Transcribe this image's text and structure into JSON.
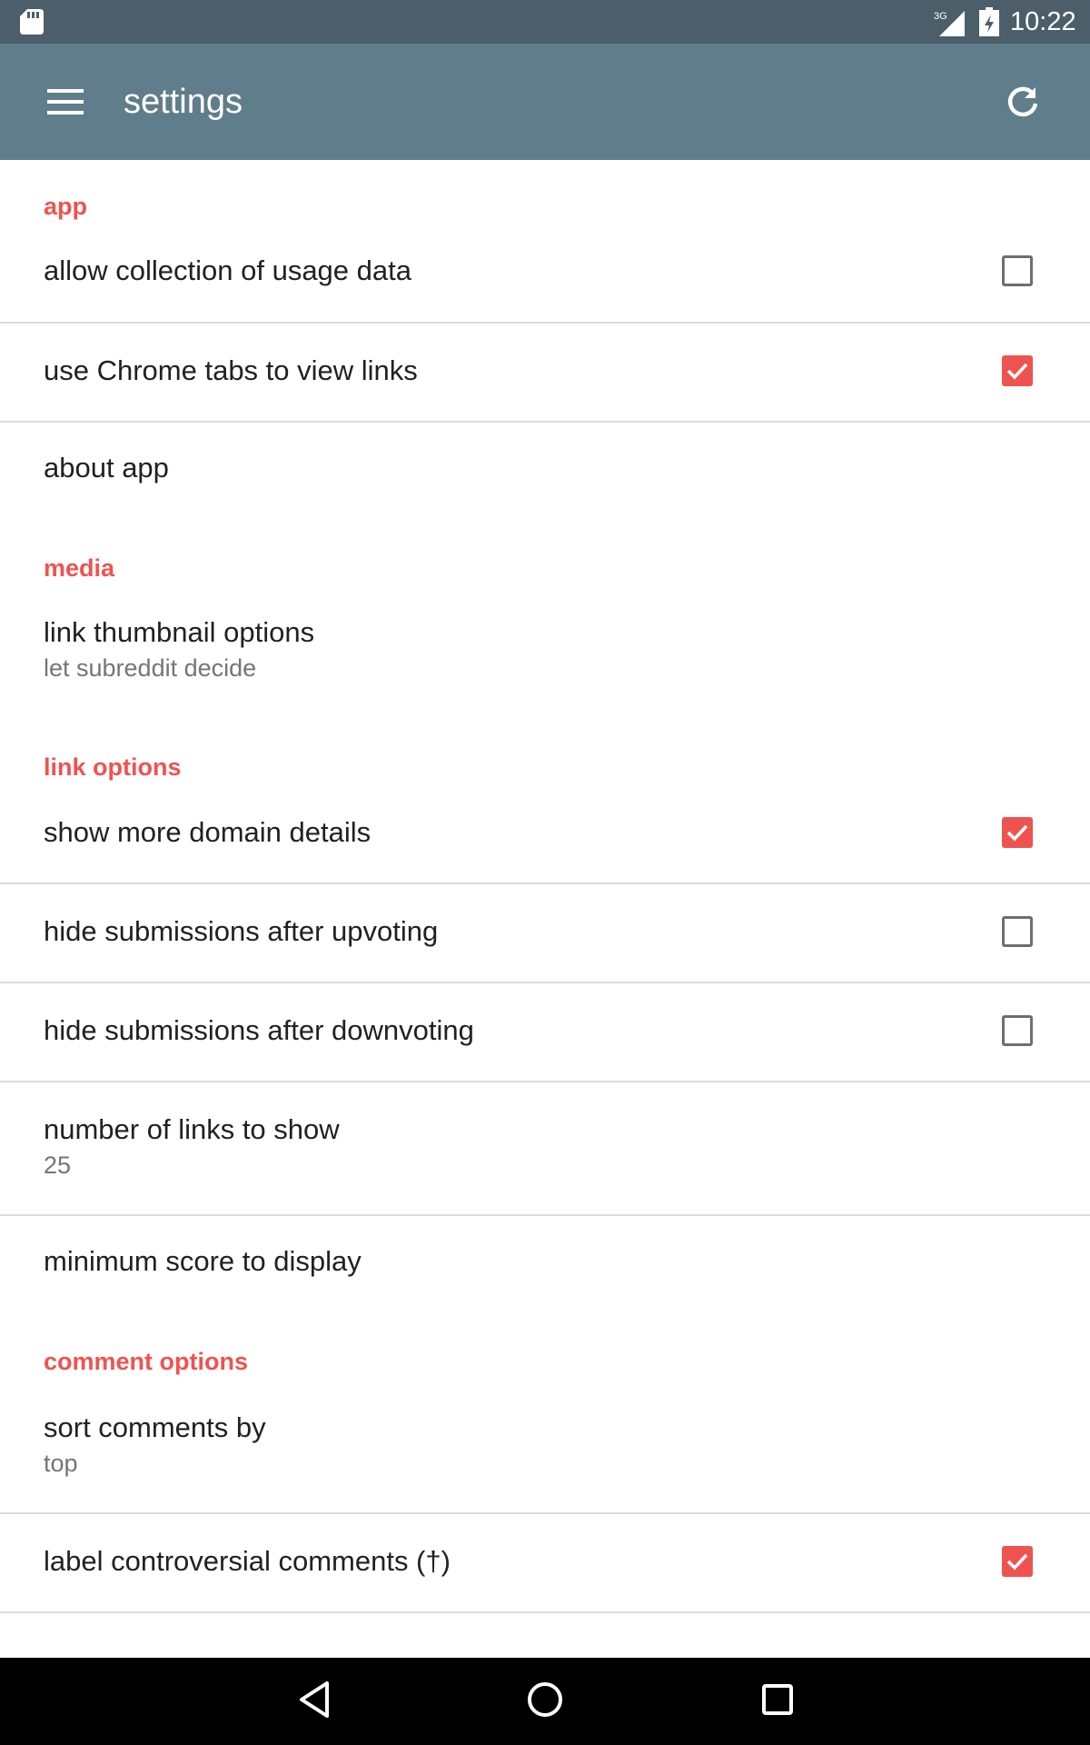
{
  "status_bar": {
    "time": "10:22",
    "network": "3G",
    "icons": [
      "sd-card-icon",
      "signal-icon",
      "battery-icon"
    ]
  },
  "toolbar": {
    "title": "settings",
    "menu_icon": "menu-icon",
    "refresh_icon": "refresh-icon",
    "background": "#607d8b"
  },
  "colors": {
    "accent": "#ef5350",
    "status_bar": "#4b5e69",
    "divider": "#dcdcdc"
  },
  "sections": {
    "app": {
      "header": "app",
      "items": [
        {
          "title": "allow collection of usage data",
          "checked": false
        },
        {
          "title": "use Chrome tabs to view links",
          "checked": true
        },
        {
          "title": "about app"
        }
      ]
    },
    "media": {
      "header": "media",
      "items": [
        {
          "title": "link thumbnail options",
          "summary": "let subreddit decide"
        }
      ]
    },
    "link_options": {
      "header": "link options",
      "items": [
        {
          "title": "show more domain details",
          "checked": true
        },
        {
          "title": "hide submissions after upvoting",
          "checked": false
        },
        {
          "title": "hide submissions after downvoting",
          "checked": false
        },
        {
          "title": "number of links to show",
          "summary": "25"
        },
        {
          "title": "minimum score to display"
        }
      ]
    },
    "comment_options": {
      "header": "comment options",
      "items": [
        {
          "title": "sort comments by",
          "summary": "top"
        },
        {
          "title": "label controversial comments (†)",
          "checked": true
        }
      ]
    }
  },
  "nav_bar": {
    "icons": [
      "back-icon",
      "home-icon",
      "recents-icon"
    ]
  }
}
